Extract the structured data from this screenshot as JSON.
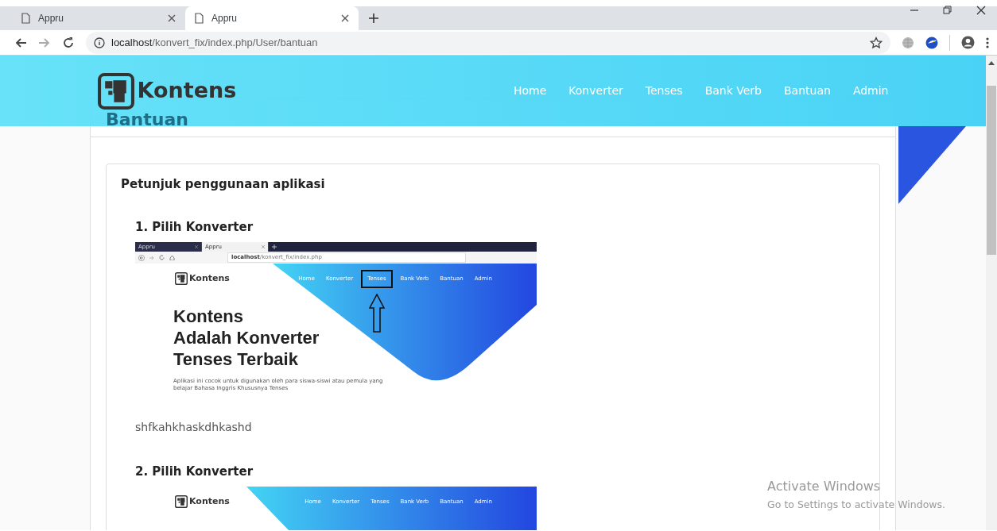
{
  "browser": {
    "tabs": [
      {
        "title": "Appru",
        "selected": false
      },
      {
        "title": "Appru",
        "selected": true
      }
    ],
    "url_host": "localhost",
    "url_path": "/konvert_fix/index.php/User/bantuan"
  },
  "navbar": {
    "brand": "Kontens",
    "links": [
      {
        "label": "Home"
      },
      {
        "label": "Konverter"
      },
      {
        "label": "Tenses"
      },
      {
        "label": "Bank Verb"
      },
      {
        "label": "Bantuan"
      },
      {
        "label": "Admin"
      }
    ]
  },
  "content": {
    "header": "Bantuan",
    "card_title": "Petunjuk penggunaan aplikasi",
    "steps": [
      {
        "title": "1. Pilih Konverter",
        "screenshot": {
          "browser": {
            "tabs": [
              {
                "title": "Appru",
                "selected": false
              },
              {
                "title": "Appru",
                "selected": true
              }
            ],
            "url_host": "localhost",
            "url_path": "/konvert_fix/index.php"
          },
          "brand": "Kontens",
          "links": [
            {
              "label": "Home",
              "highlighted": false
            },
            {
              "label": "Konverter",
              "highlighted": false
            },
            {
              "label": "Tenses",
              "highlighted": true
            },
            {
              "label": "Bank Verb",
              "highlighted": false
            },
            {
              "label": "Bantuan",
              "highlighted": false
            },
            {
              "label": "Admin",
              "highlighted": false
            }
          ],
          "hero_lines": [
            "Kontens",
            "Adalah Konverter",
            "Tenses Terbaik"
          ],
          "hero_text": "Aplikasi ini cocok untuk digunakan oleh para siswa-siswi atau pemula yang belajar Bahasa Inggris Khususnya Tenses"
        },
        "caption": "shfkahkhaskdhkashd"
      },
      {
        "title": "2. Pilih Konverter",
        "screenshot": {
          "brand": "Kontens",
          "links": [
            {
              "label": "Home",
              "highlighted": false
            },
            {
              "label": "Konverter",
              "highlighted": false
            },
            {
              "label": "Tenses",
              "highlighted": false
            },
            {
              "label": "Bank Verb",
              "highlighted": false
            },
            {
              "label": "Bantuan",
              "highlighted": false
            },
            {
              "label": "Admin",
              "highlighted": false
            }
          ]
        }
      }
    ]
  },
  "os_notice": {
    "title": "Activate Windows",
    "message": "Go to Settings to activate Windows."
  }
}
